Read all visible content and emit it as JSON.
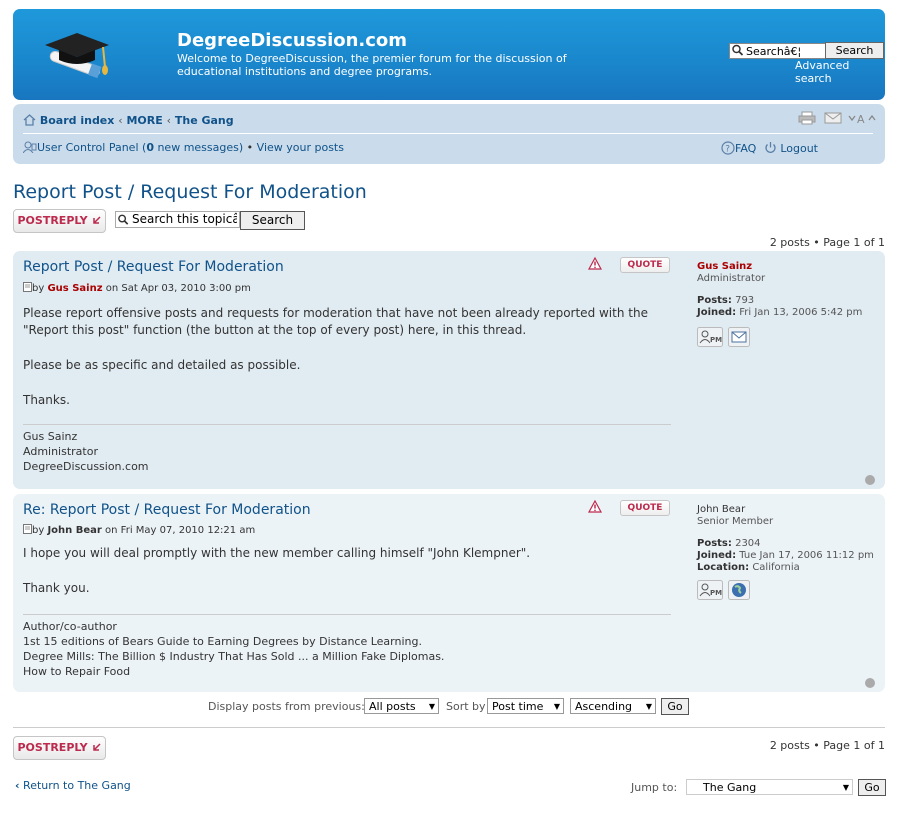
{
  "header": {
    "site_title": "DegreeDiscussion.com",
    "site_desc": "Welcome to DegreeDiscussion, the premier forum for the discussion of educational institutions and degree programs.",
    "search_placeholder": "Searchâ€¦",
    "search_button": "Search",
    "advanced_search": "Advanced search"
  },
  "nav": {
    "board_index": "Board index",
    "crumb_sep": "‹",
    "crumb_more": "MORE",
    "crumb_gang": "The Gang",
    "ucp": "User Control Panel",
    "new_msgs_pre": "(",
    "new_msgs_count": "0",
    "new_msgs_post": " new messages)",
    "bullet": "•",
    "view_posts": "View your posts",
    "faq": "FAQ",
    "logout": "Logout"
  },
  "page": {
    "title": "Report Post / Request For Moderation",
    "postreply": "POSTREPLY",
    "topic_search_placeholder": "Search this topicâ",
    "topic_search_button": "Search",
    "pagination": "2 posts • Page 1 of 1"
  },
  "posts": [
    {
      "title": "Report Post / Request For Moderation",
      "by": "by",
      "author": "Gus Sainz",
      "date": "on Sat Apr 03, 2010 3:00 pm",
      "body": [
        "Please report offensive posts and requests for moderation that have not been already reported with the \"Report this post\" function (the button at the top of every post) here, in this thread.",
        "Please be as specific and detailed as possible.",
        "Thanks."
      ],
      "signature": [
        "Gus Sainz",
        "Administrator",
        "DegreeDiscussion.com"
      ],
      "profile": {
        "name": "Gus Sainz",
        "rank": "Administrator",
        "posts_label": "Posts:",
        "posts": "793",
        "joined_label": "Joined:",
        "joined": "Fri Jan 13, 2006 5:42 pm"
      },
      "quote": "QUOTE"
    },
    {
      "title": "Re: Report Post / Request For Moderation",
      "by": "by",
      "author": "John Bear",
      "date": "on Fri May 07, 2010 12:21 am",
      "body": [
        "I hope you will deal promptly with the new member calling himself \"John Klempner\".",
        "Thank you."
      ],
      "signature": [
        "Author/co-author",
        "1st 15 editions of Bears Guide to Earning Degrees by Distance Learning.",
        "Degree Mills: The Billion $ Industry That Has Sold ... a Million Fake Diplomas.",
        "How to Repair Food"
      ],
      "profile": {
        "name": "John Bear",
        "rank": "Senior Member",
        "posts_label": "Posts:",
        "posts": "2304",
        "joined_label": "Joined:",
        "joined": "Tue Jan 17, 2006 11:12 pm",
        "location_label": "Location:",
        "location": "California"
      },
      "quote": "QUOTE"
    }
  ],
  "sort": {
    "display_label": "Display posts from previous:",
    "display_value": "All posts",
    "sort_label": "Sort by",
    "sort_value": "Post time",
    "order_value": "Ascending",
    "go": "Go"
  },
  "footer": {
    "return": "Return to The Gang",
    "jump_label": "Jump to:",
    "jump_value": "The Gang",
    "go": "Go",
    "pagination": "2 posts • Page 1 of 1"
  },
  "colors": {
    "header_blue": "#1a86cc",
    "link_blue": "#105289",
    "admin_red": "#aa0000",
    "button_red": "#bc2a4d"
  }
}
